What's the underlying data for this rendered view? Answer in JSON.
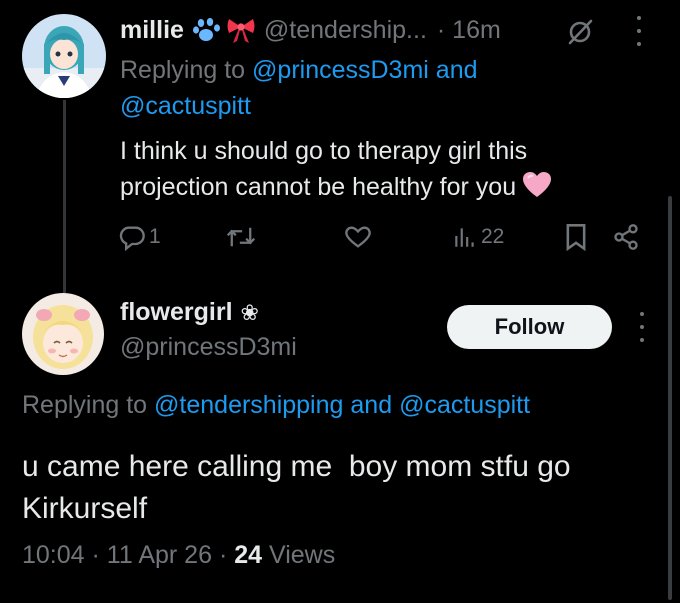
{
  "tweet1": {
    "display_name": "millie",
    "handle": "@tendership...",
    "time": "· 16m",
    "reply_prefix": "Replying to",
    "reply_to_1": "@princessD3mi",
    "reply_and": "and",
    "reply_to_2": "@cactuspitt",
    "text": "I think u should go to therapy girl this projection cannot be healthy for you",
    "replies": "1",
    "retweets": "",
    "likes": "",
    "views": "22"
  },
  "tweet2": {
    "display_name": "flowergirl",
    "name_symbol": "❀",
    "handle": "@princessD3mi",
    "follow_label": "Follow",
    "reply_prefix": "Replying to",
    "reply_to_1": "@tendershipping",
    "reply_and": "and",
    "reply_to_2": "@cactuspitt",
    "text": "u came here calling me  boy mom stfu go Kirkurself",
    "time": "10:04",
    "sep1": "·",
    "date": "11 Apr 26",
    "sep2": "·",
    "views_count": "24",
    "views_label": "Views"
  },
  "colors": {
    "background": "#000000",
    "text_primary": "#e7e9ea",
    "text_secondary": "#71767b",
    "link": "#1d9bf0",
    "follow_button_bg": "#eff3f4",
    "thread_line": "#333639"
  },
  "icons": [
    "paw-emoji-icon",
    "ribbon-emoji-icon",
    "grok-icon",
    "more-icon",
    "reply-icon",
    "retweet-icon",
    "like-icon",
    "views-icon",
    "bookmark-icon",
    "share-icon",
    "heart-emoji-icon"
  ]
}
